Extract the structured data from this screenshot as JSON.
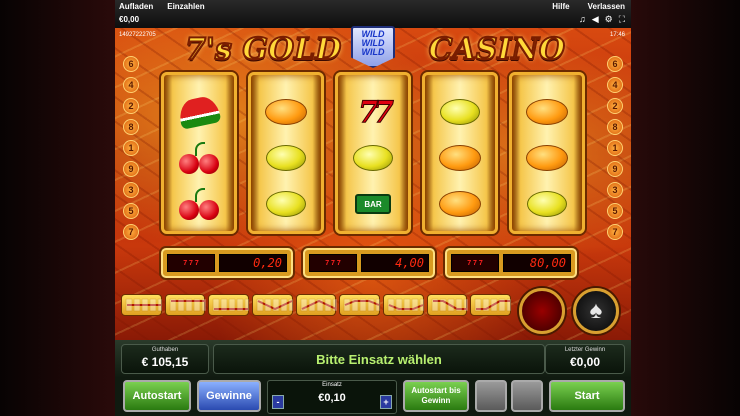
{
  "topbar": {
    "recharge": "Aufladen",
    "payout": "Einzahlen",
    "balance": "€0,00",
    "help": "Hilfe",
    "leave": "Verlassen",
    "icons": [
      "music-note-icon",
      "sound-icon",
      "settings-icon",
      "fullscreen-icon"
    ]
  },
  "ticket_number": "14927222705",
  "clock": "17:46",
  "logo": {
    "left": "7's GOLD",
    "right": "CASINO"
  },
  "wild": [
    "WILD",
    "WILD",
    "WILD"
  ],
  "lines_left": [
    "6",
    "4",
    "2",
    "8",
    "1",
    "9",
    "3",
    "5",
    "7"
  ],
  "lines_right": [
    "6",
    "4",
    "2",
    "8",
    "1",
    "9",
    "3",
    "5",
    "7"
  ],
  "reels": [
    [
      "melon",
      "cherry",
      "cherry"
    ],
    [
      "orange",
      "lemon",
      "lemon"
    ],
    [
      "seven",
      "lemon",
      "bar"
    ],
    [
      "lemon",
      "orange",
      "orange"
    ],
    [
      "orange",
      "orange",
      "lemon"
    ]
  ],
  "bar_label": "BAR",
  "win_displays": [
    {
      "symbols": "7 7 7",
      "value": "0,20"
    },
    {
      "symbols": "7 7 7",
      "value": "4,00"
    },
    {
      "symbols": "7 7 7",
      "value": "80,00"
    }
  ],
  "info": {
    "credit_label": "Guthaben",
    "credit_value": "€ 105,15",
    "message": "Bitte Einsatz wählen",
    "last_win_label": "Letzter Gewinn",
    "last_win_value": "€0,00"
  },
  "buttons": {
    "autostart": "Autostart",
    "gains": "Gewinne",
    "stake_label": "Einsatz",
    "stake_value": "€0,10",
    "minus": "-",
    "plus": "+",
    "autostart_until_win": "Autostart bis Gewinn",
    "start": "Start"
  },
  "colors": {
    "accent_gold": "#ffd93a",
    "fire_red": "#c8380c",
    "btn_green": "#2a7a10",
    "btn_blue": "#2a4ab0"
  }
}
